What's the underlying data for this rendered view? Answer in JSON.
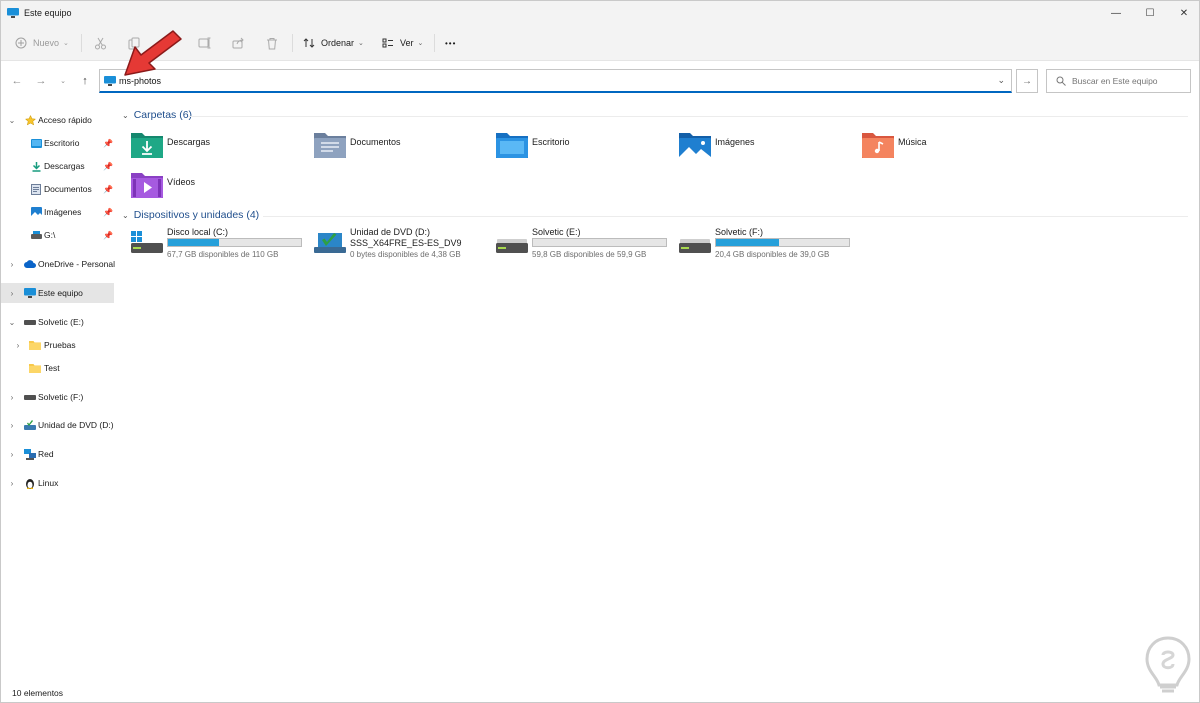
{
  "window": {
    "title": "Este equipo",
    "controls": {
      "minimize": "—",
      "maximize": "☐",
      "close": "✕"
    }
  },
  "toolbar": {
    "new_label": "Nuevo",
    "sort_label": "Ordenar",
    "view_label": "Ver",
    "more_label": "•••"
  },
  "address": {
    "value": "ms-photos",
    "search_placeholder": "Buscar en Este equipo"
  },
  "sidebar": {
    "items": [
      {
        "label": "Acceso rápido",
        "icon": "star-icon"
      },
      {
        "label": "Escritorio",
        "icon": "desktop-folder-icon"
      },
      {
        "label": "Descargas",
        "icon": "downloads-icon"
      },
      {
        "label": "Documentos",
        "icon": "documents-icon"
      },
      {
        "label": "Imágenes",
        "icon": "pictures-icon"
      },
      {
        "label": "G:\\",
        "icon": "drive-g-icon"
      },
      {
        "label": "OneDrive - Personal",
        "icon": "cloud-icon"
      },
      {
        "label": "Este equipo",
        "icon": "this-pc-icon"
      },
      {
        "label": "Solvetic (E:)",
        "icon": "drive-icon"
      },
      {
        "label": "Pruebas",
        "icon": "folder-icon"
      },
      {
        "label": "Test",
        "icon": "folder-icon"
      },
      {
        "label": "Solvetic (F:)",
        "icon": "drive-icon"
      },
      {
        "label": "Unidad de DVD (D:)",
        "icon": "dvd-icon"
      },
      {
        "label": "Red",
        "icon": "network-icon"
      },
      {
        "label": "Linux",
        "icon": "linux-icon"
      }
    ]
  },
  "main": {
    "folders_header": "Carpetas (6)",
    "folders": [
      {
        "label": "Descargas"
      },
      {
        "label": "Documentos"
      },
      {
        "label": "Escritorio"
      },
      {
        "label": "Imágenes"
      },
      {
        "label": "Música"
      },
      {
        "label": "Vídeos"
      }
    ],
    "drives_header": "Dispositivos y unidades (4)",
    "drives": [
      {
        "name": "Disco local (C:)",
        "free": "67,7 GB disponibles de 110 GB",
        "used_fraction": 0.38
      },
      {
        "name": "Unidad de DVD (D:)",
        "sub": "SSS_X64FRE_ES-ES_DV9",
        "free": "0 bytes disponibles de 4,38 GB"
      },
      {
        "name": "Solvetic (E:)",
        "free": "59,8 GB disponibles de 59,9 GB",
        "used_fraction": 0.0
      },
      {
        "name": "Solvetic (F:)",
        "free": "20,4 GB disponibles de 39,0 GB",
        "used_fraction": 0.47
      }
    ]
  },
  "status": {
    "items_count": "10 elementos"
  },
  "colors": {
    "accent": "#0067c0",
    "drive_bar": "#26a0da",
    "header_text": "#1f4e8c",
    "annotation_arrow": "#e53935"
  }
}
